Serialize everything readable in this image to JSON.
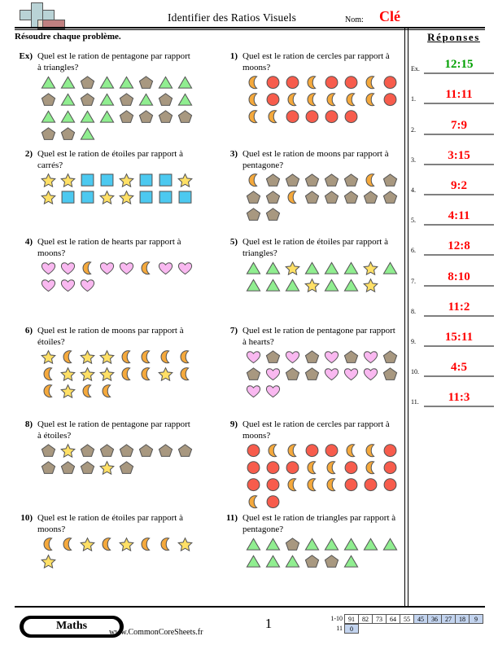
{
  "header": {
    "title": "Identifier des Ratios Visuels",
    "name_label": "Nom:",
    "name_value": "Clé",
    "instructions": "Résoudre chaque problème.",
    "logo_name": "commoncoresheets-logo"
  },
  "answers": {
    "title": "Réponses",
    "rows": [
      {
        "num": "Ex.",
        "value": "12:15",
        "example": true
      },
      {
        "num": "1.",
        "value": "11:11"
      },
      {
        "num": "2.",
        "value": "7:9"
      },
      {
        "num": "3.",
        "value": "3:15"
      },
      {
        "num": "4.",
        "value": "9:2"
      },
      {
        "num": "5.",
        "value": "4:11"
      },
      {
        "num": "6.",
        "value": "12:8"
      },
      {
        "num": "7.",
        "value": "8:10"
      },
      {
        "num": "8.",
        "value": "11:2"
      },
      {
        "num": "9.",
        "value": "15:11"
      },
      {
        "num": "10.",
        "value": "4:5"
      },
      {
        "num": "11.",
        "value": "11:3"
      }
    ],
    "example_color": "#00a000",
    "answer_color": "#ff0000"
  },
  "problems": [
    {
      "num": "Ex)",
      "text": "Quel est le ration de pentagone par rapport à triangles?",
      "rows": [
        [
          "triangle",
          "triangle",
          "pentagon",
          "triangle",
          "triangle",
          "pentagon",
          "triangle",
          "triangle"
        ],
        [
          "pentagon",
          "triangle",
          "pentagon",
          "triangle",
          "pentagon",
          "triangle",
          "pentagon",
          "triangle"
        ],
        [
          "triangle",
          "triangle",
          "triangle",
          "triangle",
          "pentagon",
          "pentagon",
          "pentagon",
          "pentagon"
        ],
        [
          "pentagon",
          "pentagon",
          "triangle"
        ]
      ]
    },
    {
      "num": "1)",
      "text": "Quel est le ration de cercles par rapport à moons?",
      "rows": [
        [
          "moon",
          "circle",
          "circle",
          "moon",
          "circle",
          "circle",
          "moon",
          "circle"
        ],
        [
          "moon",
          "circle",
          "moon",
          "moon",
          "moon",
          "moon",
          "moon",
          "circle"
        ],
        [
          "moon",
          "moon",
          "circle",
          "circle",
          "circle",
          "circle"
        ]
      ]
    },
    {
      "num": "2)",
      "text": "Quel est le ration de étoiles par rapport à carrés?",
      "rows": [
        [
          "star",
          "star",
          "square",
          "square",
          "star",
          "square",
          "square",
          "star"
        ],
        [
          "star",
          "square",
          "square",
          "star",
          "star",
          "square",
          "square",
          "square"
        ]
      ]
    },
    {
      "num": "3)",
      "text": "Quel est le ration de moons par rapport à pentagone?",
      "rows": [
        [
          "moon",
          "pentagon",
          "pentagon",
          "pentagon",
          "pentagon",
          "pentagon",
          "moon",
          "pentagon"
        ],
        [
          "pentagon",
          "pentagon",
          "moon",
          "pentagon",
          "pentagon",
          "pentagon",
          "pentagon",
          "pentagon"
        ],
        [
          "pentagon",
          "pentagon"
        ]
      ]
    },
    {
      "num": "4)",
      "text": "Quel est le ration de hearts par rapport à moons?",
      "rows": [
        [
          "heart",
          "heart",
          "moon",
          "heart",
          "heart",
          "moon",
          "heart",
          "heart"
        ],
        [
          "heart",
          "heart",
          "heart"
        ]
      ]
    },
    {
      "num": "5)",
      "text": "Quel est le ration de étoiles par rapport à triangles?",
      "rows": [
        [
          "triangle",
          "triangle",
          "star",
          "triangle",
          "triangle",
          "triangle",
          "star",
          "triangle"
        ],
        [
          "triangle",
          "triangle",
          "triangle",
          "star",
          "triangle",
          "triangle",
          "star"
        ]
      ]
    },
    {
      "num": "6)",
      "text": "Quel est le ration de moons par rapport à étoiles?",
      "rows": [
        [
          "star",
          "moon",
          "star",
          "star",
          "moon",
          "moon",
          "moon",
          "moon"
        ],
        [
          "moon",
          "star",
          "star",
          "star",
          "moon",
          "moon",
          "star",
          "moon"
        ],
        [
          "moon",
          "star",
          "moon",
          "moon"
        ]
      ]
    },
    {
      "num": "7)",
      "text": "Quel est le ration de pentagone par rapport à hearts?",
      "rows": [
        [
          "heart",
          "pentagon",
          "heart",
          "pentagon",
          "heart",
          "pentagon",
          "heart",
          "pentagon"
        ],
        [
          "pentagon",
          "heart",
          "pentagon",
          "pentagon",
          "heart",
          "heart",
          "heart",
          "pentagon"
        ],
        [
          "heart",
          "heart"
        ]
      ]
    },
    {
      "num": "8)",
      "text": "Quel est le ration de pentagone par rapport à étoiles?",
      "rows": [
        [
          "pentagon",
          "star",
          "pentagon",
          "pentagon",
          "pentagon",
          "pentagon",
          "pentagon",
          "pentagon"
        ],
        [
          "pentagon",
          "pentagon",
          "pentagon",
          "star",
          "pentagon"
        ]
      ]
    },
    {
      "num": "9)",
      "text": "Quel est le ration de cercles par rapport à moons?",
      "rows": [
        [
          "circle",
          "moon",
          "moon",
          "circle",
          "circle",
          "moon",
          "moon",
          "circle"
        ],
        [
          "circle",
          "circle",
          "circle",
          "moon",
          "moon",
          "circle",
          "moon",
          "circle"
        ],
        [
          "circle",
          "circle",
          "moon",
          "moon",
          "moon",
          "circle",
          "circle",
          "circle"
        ],
        [
          "moon",
          "circle"
        ]
      ]
    },
    {
      "num": "10)",
      "text": "Quel est le ration de étoiles par rapport à moons?",
      "rows": [
        [
          "moon",
          "moon",
          "star",
          "moon",
          "star",
          "moon",
          "moon",
          "star"
        ],
        [
          "star"
        ]
      ]
    },
    {
      "num": "11)",
      "text": "Quel est le ration de triangles par rapport à pentagone?",
      "rows": [
        [
          "triangle",
          "triangle",
          "pentagon",
          "triangle",
          "triangle",
          "triangle",
          "triangle",
          "triangle"
        ],
        [
          "triangle",
          "triangle",
          "triangle",
          "pentagon",
          "pentagon",
          "triangle"
        ]
      ]
    }
  ],
  "shape_colors": {
    "triangle": "#90ee90",
    "pentagon": "#a89880",
    "circle": "#f75c4c",
    "moon": "#f5a93c",
    "star": "#ffe066",
    "square": "#4cc9f0",
    "heart": "#f9b8f0"
  },
  "footer": {
    "brand": "Maths",
    "site": "www.CommonCoreSheets.fr",
    "page_number": "1",
    "score_table": {
      "rows": [
        {
          "label": "1-10",
          "cells": [
            {
              "v": "91",
              "hl": false
            },
            {
              "v": "82",
              "hl": false
            },
            {
              "v": "73",
              "hl": false
            },
            {
              "v": "64",
              "hl": false
            },
            {
              "v": "55",
              "hl": false
            },
            {
              "v": "45",
              "hl": true
            },
            {
              "v": "36",
              "hl": true
            },
            {
              "v": "27",
              "hl": true
            },
            {
              "v": "18",
              "hl": true
            },
            {
              "v": "9",
              "hl": true
            }
          ]
        },
        {
          "label": "11",
          "cells": [
            {
              "v": "0",
              "hl": true
            }
          ]
        }
      ]
    }
  }
}
